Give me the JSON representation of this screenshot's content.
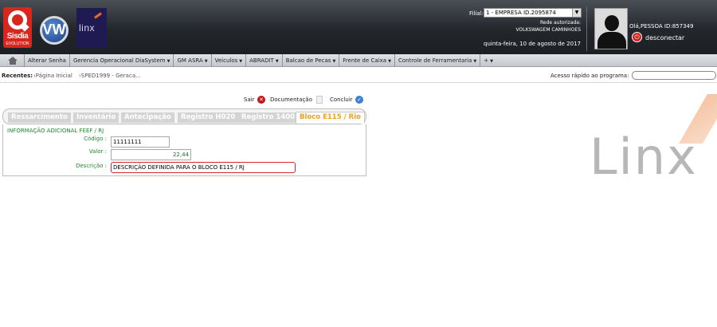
{
  "header": {
    "logo_sisdia_text": "Sisdia",
    "logo_sisdia_sub": "EVOLUTION",
    "logo_vw": "VW",
    "logo_linx_small": "linx",
    "filial_label": "Filial:",
    "filial_value": "1 - EMPRESA ID.2095874",
    "rede_label": "Rede autorizada:",
    "rede_value": "VOLKSWAGEM CAMINHOES",
    "date": "quinta-feira, 10 de agosto de 2017",
    "user": "Olá,PESSOA ID:857349",
    "disconnect": "desconectar"
  },
  "menu": {
    "items": [
      {
        "label": "Alterar Senha",
        "caret": ""
      },
      {
        "label": "Gerencia Operacional DiaSystem",
        "caret": "▼"
      },
      {
        "label": "GM ASRA",
        "caret": "▼"
      },
      {
        "label": "Veiculos",
        "caret": "▼"
      },
      {
        "label": "ABRADIT",
        "caret": "▼"
      },
      {
        "label": "Balcao de Pecas",
        "caret": "▼"
      },
      {
        "label": "Frente de Caixa",
        "caret": "▼"
      },
      {
        "label": "Controle de Ferramentaria",
        "caret": "▼"
      },
      {
        "label": "+",
        "caret": "▼"
      }
    ]
  },
  "recentes": {
    "label": "Recentes:",
    "item1": "›Página Inicial",
    "item2": "›SPED1999 - Geraca...",
    "acesso_label": "Acesso rápido ao programa:",
    "acesso_value": ""
  },
  "actions": {
    "sair": "Sair",
    "documentacao": "Documentação",
    "concluir": "Concluir"
  },
  "tabs": [
    {
      "label": "Ressarcimento"
    },
    {
      "label": "Inventário"
    },
    {
      "label": "Antecipação"
    },
    {
      "label": "Registro H020"
    },
    {
      "label": "Registro 1400"
    }
  ],
  "active_tab": {
    "label": "Bloco E115",
    "sep": " / ",
    "suffix": "Rio"
  },
  "form": {
    "section_title": "INFORMAÇÃO ADICIONAL FEEF / RJ",
    "codigo_label": "Código :",
    "codigo_value": "11111111",
    "valor_label": "Valor :",
    "valor_value": "22,44",
    "descricao_label": "Descrição :",
    "descricao_value": "DESCRIÇÃO DEFINIDA PARA O BLOCO E115 / RJ"
  },
  "watermark": "Linx",
  "colors": {
    "header_bg": "#23272c",
    "active_tab": "#f1a01a",
    "form_label": "#1f8a2e",
    "desc_border": "#d42a2a",
    "inactive_tab": "#d4d4d4"
  }
}
